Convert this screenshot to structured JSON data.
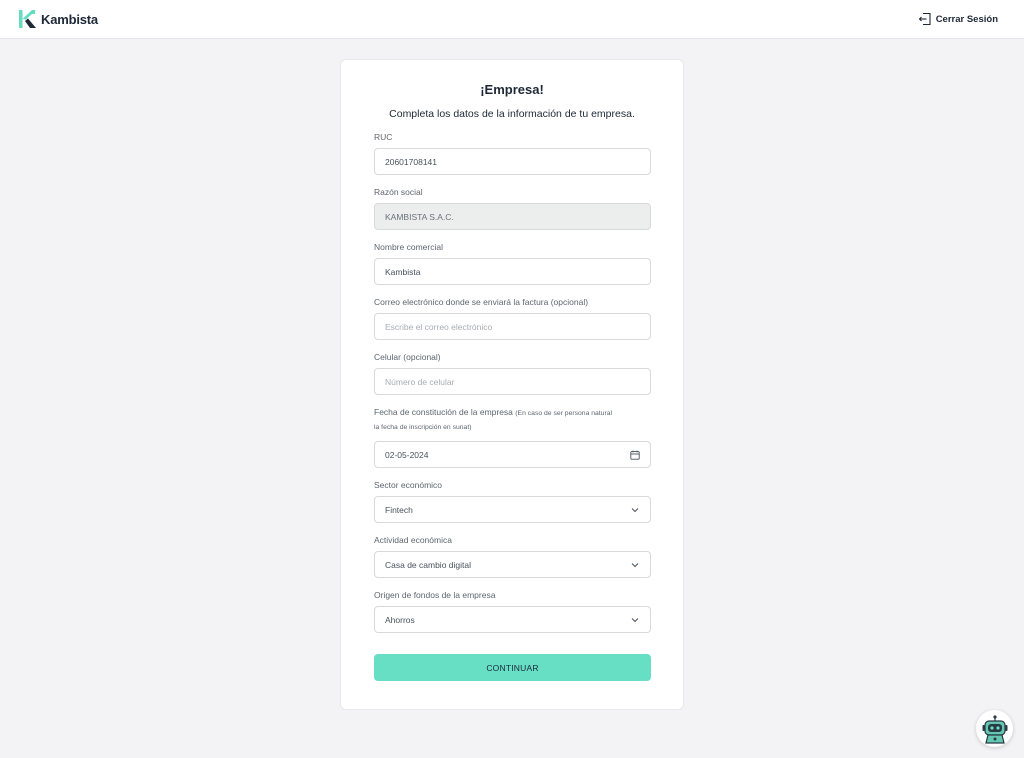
{
  "colors": {
    "accent": "#67dfc4",
    "brand_text": "#1d2937",
    "background": "#f3f3f5"
  },
  "header": {
    "brand": "Kambista",
    "logo_icon": "kambista-k-logo",
    "logout_icon": "logout-door-icon",
    "logout_label": "Cerrar Sesión"
  },
  "form": {
    "title": "¡Empresa!",
    "subtitle": "Completa los datos de la información de tu empresa.",
    "ruc": {
      "label": "RUC",
      "value": "20601708141"
    },
    "razon_social": {
      "label": "Razón social",
      "value": "KAMBISTA S.A.C."
    },
    "nombre_comercial": {
      "label": "Nombre comercial",
      "value": "Kambista"
    },
    "correo": {
      "label": "Correo electrónico donde se enviará la factura (opcional)",
      "value": "",
      "placeholder": "Escribe el correo electrónico"
    },
    "celular": {
      "label": "Celular (opcional)",
      "value": "",
      "placeholder": "Número de celular"
    },
    "fecha": {
      "label": "Fecha de constitución de la empresa",
      "note_line1": "(En caso de ser persona natural",
      "note_line2": "la fecha de inscripción en sunat)",
      "value": "02-05-2024",
      "icon": "calendar-icon"
    },
    "sector": {
      "label": "Sector económico",
      "value": "Fintech",
      "icon": "chevron-down-icon"
    },
    "actividad": {
      "label": "Actividad económica",
      "value": "Casa de cambio digital",
      "icon": "chevron-down-icon"
    },
    "origen": {
      "label": "Origen de fondos de la empresa",
      "value": "Ahorros",
      "icon": "chevron-down-icon"
    },
    "submit_label": "CONTINUAR"
  },
  "chat": {
    "icon": "robot-chat-icon"
  }
}
